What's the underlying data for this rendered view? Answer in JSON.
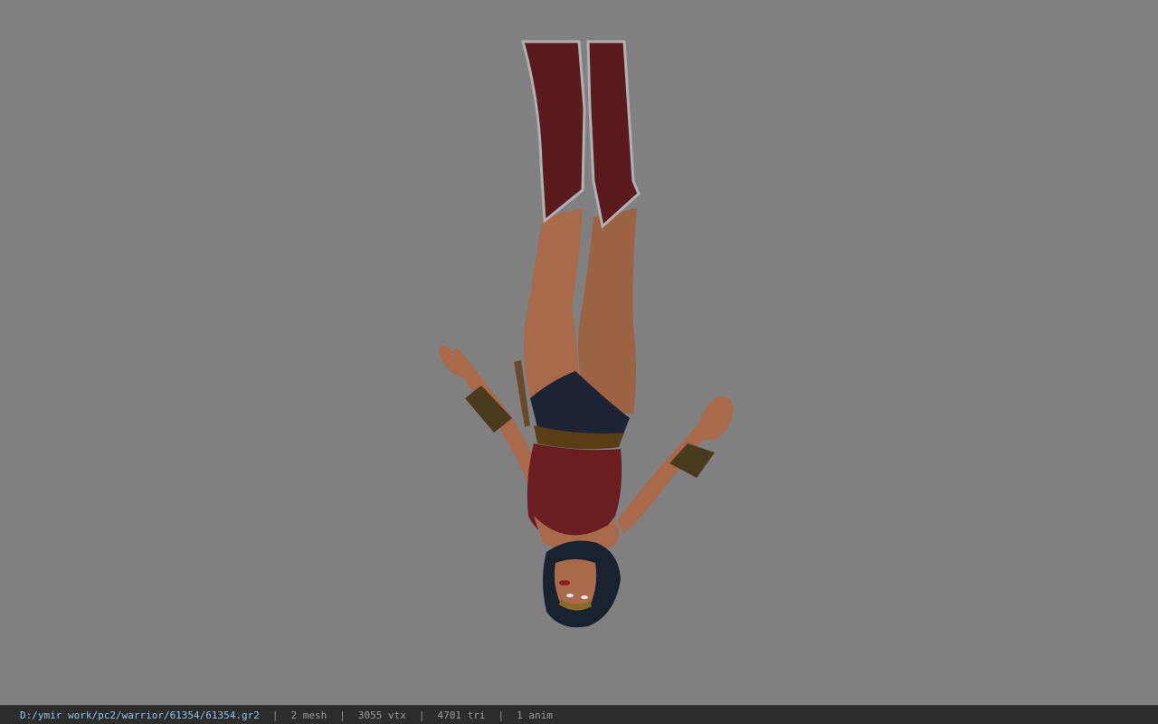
{
  "viewer": {
    "background_color": "#808080",
    "model_icon": "character-model-icon"
  },
  "status": {
    "file_path": "D:/ymir work/pc2/warrior/61354/61354.gr2",
    "separator": "|",
    "mesh": "2 mesh",
    "vtx": "3055 vtx",
    "tri": "4701 tri",
    "anim": "1 anim"
  },
  "colors": {
    "statusbar_bg": "#2d2d2d",
    "path_text": "#8fc4e8",
    "stat_text": "#9a9a9a"
  }
}
